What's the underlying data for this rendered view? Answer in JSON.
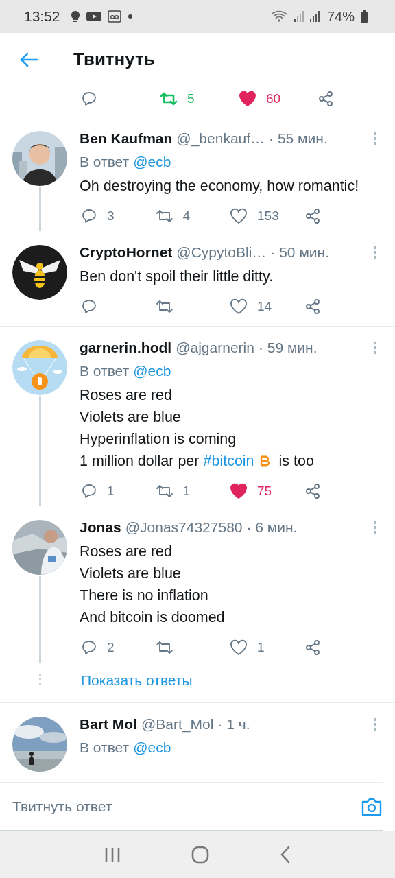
{
  "status_bar": {
    "time": "13:52",
    "battery": "74%"
  },
  "header": {
    "title": "Твитнуть"
  },
  "main_actions": {
    "retweets": "5",
    "retweeted": true,
    "likes": "60",
    "liked": true
  },
  "threads": [
    {
      "tweets": [
        {
          "name": "Ben Kaufman",
          "handle": "@_benkauf…",
          "time": "· 55 мин.",
          "reply_prefix": "В ответ",
          "reply_to": "@ecb",
          "lines": [
            [
              {
                "kind": "text",
                "text": "Oh destroying the economy, how romantic!"
              }
            ]
          ],
          "actions": {
            "replies": "3",
            "retweets": "4",
            "likes": "153",
            "liked": false,
            "retweeted": false
          }
        },
        {
          "name": "CryptoHornet",
          "handle": "@CypytoBli…",
          "time": "· 50 мин.",
          "lines": [
            [
              {
                "kind": "text",
                "text": "Ben don't spoil their little ditty."
              }
            ]
          ],
          "actions": {
            "likes": "14",
            "liked": false,
            "retweeted": false
          }
        }
      ]
    },
    {
      "tweets": [
        {
          "name": "garnerin.hodl",
          "handle": "@ajgarnerin",
          "time": "· 59 мин.",
          "reply_prefix": "В ответ",
          "reply_to": "@ecb",
          "lines": [
            [
              {
                "kind": "text",
                "text": "Roses are red"
              }
            ],
            [
              {
                "kind": "text",
                "text": "Violets are blue"
              }
            ],
            [
              {
                "kind": "text",
                "text": "Hyperinflation is coming"
              }
            ],
            [
              {
                "kind": "text",
                "text": "1 million dollar per"
              },
              {
                "kind": "hashtag",
                "text": "#bitcoin"
              },
              {
                "kind": "bitcoin"
              },
              {
                "kind": "text",
                "text": "is too"
              }
            ]
          ],
          "actions": {
            "replies": "1",
            "retweets": "1",
            "likes": "75",
            "liked": true,
            "retweeted": false
          }
        },
        {
          "name": "Jonas",
          "handle": "@Jonas74327580",
          "time": "· 6 мин.",
          "lines": [
            [
              {
                "kind": "text",
                "text": "Roses are red"
              }
            ],
            [
              {
                "kind": "text",
                "text": "Violets are blue"
              }
            ],
            [
              {
                "kind": "text",
                "text": "There is no inflation"
              }
            ],
            [
              {
                "kind": "text",
                "text": "And bitcoin is doomed"
              }
            ]
          ],
          "actions": {
            "replies": "2",
            "likes": "1",
            "liked": false,
            "retweeted": false
          }
        }
      ],
      "show_replies": "Показать ответы"
    },
    {
      "tweets": [
        {
          "name": "Bart Mol",
          "handle": "@Bart_Mol",
          "time": "· 1 ч.",
          "reply_prefix": "В ответ",
          "reply_to": "@ecb"
        }
      ]
    }
  ],
  "reply_bar": {
    "placeholder": "Твитнуть ответ"
  }
}
